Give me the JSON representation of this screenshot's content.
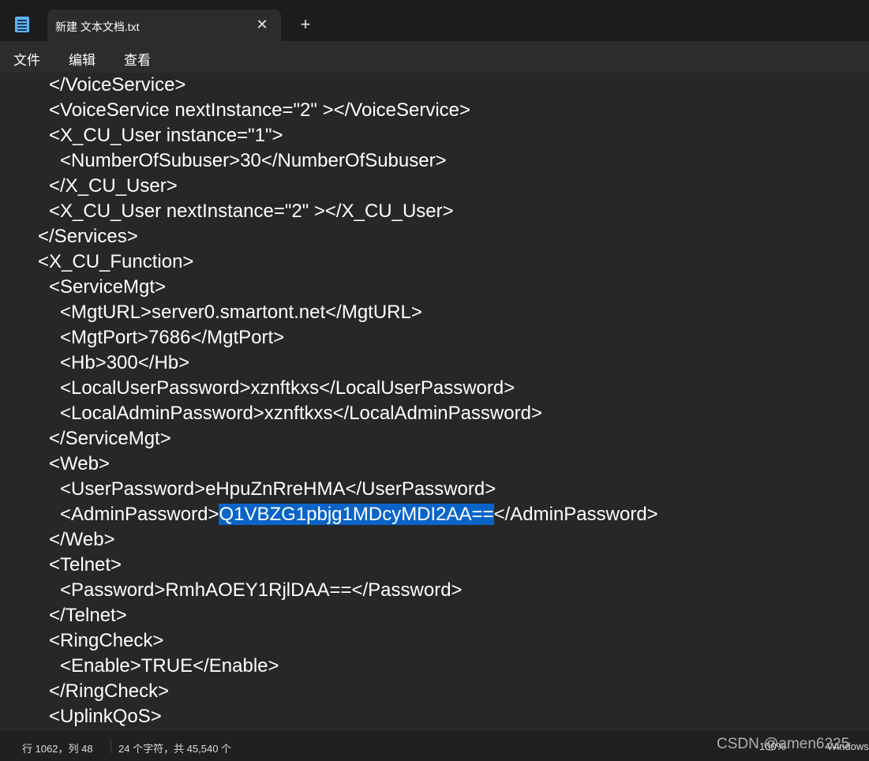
{
  "tab": {
    "title": "新建 文本文档.txt",
    "close": "✕",
    "new": "+"
  },
  "menu": {
    "file": "文件",
    "edit": "编辑",
    "view": "查看"
  },
  "lines": [
    "</VoiceService>",
    "<VoiceService nextInstance=\"2\" ></VoiceService>",
    "<X_CU_User instance=\"1\">",
    "<NumberOfSubuser>30</NumberOfSubuser>",
    "</X_CU_User>",
    "<X_CU_User nextInstance=\"2\" ></X_CU_User>",
    "</Services>",
    "<X_CU_Function>",
    "<ServiceMgt>",
    "<MgtURL>server0.smartont.net</MgtURL>",
    "<MgtPort>7686</MgtPort>",
    "<Hb>300</Hb>",
    "<LocalUserPassword>xznftkxs</LocalUserPassword>",
    "<LocalAdminPassword>xznftkxs</LocalAdminPassword>",
    "</ServiceMgt>",
    "<Web>",
    "<UserPassword>eHpuZnRreHMA</UserPassword>",
    "</Web>",
    "<Telnet>",
    "<Password>RmhAOEY1RjlDAA==</Password>",
    "</Telnet>",
    "<RingCheck>",
    "<Enable>TRUE</Enable>",
    "</RingCheck>",
    "<UplinkQoS>"
  ],
  "admin_line": {
    "prefix": "<AdminPassword>",
    "selected": "Q1VBZG1pbjg1MDcyMDI2AA==",
    "suffix": "</AdminPassword>"
  },
  "status": {
    "position": "行 1062，列 48",
    "chars": "24 个字符，共 45,540 个",
    "zoom": "100%",
    "line_ending": "Windows"
  },
  "watermark": "CSDN @amen6225"
}
